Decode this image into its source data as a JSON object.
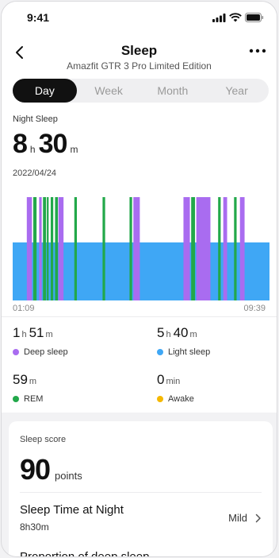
{
  "status_bar": {
    "time": "9:41"
  },
  "nav": {
    "title": "Sleep",
    "subtitle": "Amazfit GTR 3 Pro Limited Edition"
  },
  "tabs": [
    {
      "label": "Day",
      "active": true
    },
    {
      "label": "Week",
      "active": false
    },
    {
      "label": "Month",
      "active": false
    },
    {
      "label": "Year",
      "active": false
    }
  ],
  "night_sleep": {
    "heading": "Night Sleep",
    "hours": "8",
    "hours_unit": "h",
    "minutes": "30",
    "minutes_unit": "m",
    "date": "2022/04/24",
    "start_time": "01:09",
    "end_time": "09:39"
  },
  "colors": {
    "deep": "#a96cf0",
    "light": "#3fa7f5",
    "rem": "#22a84a",
    "awake": "#f5b800"
  },
  "chart_data": {
    "type": "timeline",
    "segments": [
      {
        "stage": "deep",
        "start": 0.055,
        "end": 0.075
      },
      {
        "stage": "rem",
        "start": 0.08,
        "end": 0.093
      },
      {
        "stage": "deep",
        "start": 0.103,
        "end": 0.113
      },
      {
        "stage": "rem",
        "start": 0.118,
        "end": 0.13
      },
      {
        "stage": "rem",
        "start": 0.133,
        "end": 0.14
      },
      {
        "stage": "rem",
        "start": 0.148,
        "end": 0.158
      },
      {
        "stage": "rem",
        "start": 0.165,
        "end": 0.176
      },
      {
        "stage": "deep",
        "start": 0.178,
        "end": 0.198
      },
      {
        "stage": "rem",
        "start": 0.24,
        "end": 0.25
      },
      {
        "stage": "rem",
        "start": 0.35,
        "end": 0.36
      },
      {
        "stage": "rem",
        "start": 0.455,
        "end": 0.465
      },
      {
        "stage": "deep",
        "start": 0.47,
        "end": 0.495
      },
      {
        "stage": "deep",
        "start": 0.665,
        "end": 0.69
      },
      {
        "stage": "rem",
        "start": 0.695,
        "end": 0.71
      },
      {
        "stage": "deep",
        "start": 0.715,
        "end": 0.77
      },
      {
        "stage": "rem",
        "start": 0.8,
        "end": 0.81
      },
      {
        "stage": "deep",
        "start": 0.82,
        "end": 0.835
      },
      {
        "stage": "rem",
        "start": 0.862,
        "end": 0.872
      },
      {
        "stage": "deep",
        "start": 0.885,
        "end": 0.903
      }
    ]
  },
  "stats": [
    {
      "value_a": "1",
      "unit_a": "h",
      "value_b": "51",
      "unit_b": "m",
      "label": "Deep sleep",
      "color": "deep"
    },
    {
      "value_a": "5",
      "unit_a": "h",
      "value_b": "40",
      "unit_b": "m",
      "label": "Light sleep",
      "color": "light"
    },
    {
      "value_a": "59",
      "unit_a": "m",
      "value_b": "",
      "unit_b": "",
      "label": "REM",
      "color": "rem"
    },
    {
      "value_a": "0",
      "unit_a": "min",
      "value_b": "",
      "unit_b": "",
      "label": "Awake",
      "color": "awake"
    }
  ],
  "score": {
    "label": "Sleep score",
    "value": "90",
    "unit": "points",
    "row1_title": "Sleep Time at Night",
    "row1_sub": "8h30m",
    "row1_level": "Mild",
    "row2_title": "Proportion of deep sleep"
  }
}
